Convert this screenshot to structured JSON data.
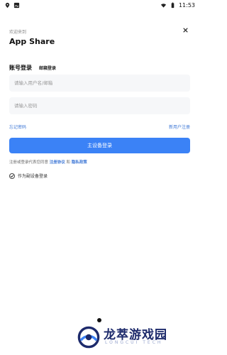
{
  "status_bar": {
    "time": "11:53",
    "left_icons": [
      "location-icon",
      "image-icon"
    ],
    "right_icons": [
      "wifi-icon",
      "battery-icon"
    ]
  },
  "header": {
    "welcome": "欢迎来到",
    "title": "App Share",
    "close_glyph": "×"
  },
  "tabs": {
    "account_login": "账号登录",
    "email_login": "邮箱登录",
    "active": "account_login"
  },
  "form": {
    "username_placeholder": "请输入用户名/邮箱",
    "username_value": "",
    "password_placeholder": "请输入密码",
    "password_value": ""
  },
  "links": {
    "forgot_password": "忘记密码",
    "register": "新用户注册"
  },
  "buttons": {
    "login": "主设备登录"
  },
  "agreement": {
    "prefix": "注册或登录代表您同意",
    "terms": "注册协议",
    "and": "和",
    "privacy": "隐私政策"
  },
  "as_secondary_device": {
    "label": "作为副设备登录",
    "checked": true
  },
  "watermark": {
    "text": "龙萃游戏园",
    "sub": "LONGCUI TECH"
  },
  "colors": {
    "accent": "#3b82f6",
    "link": "#3f78d6",
    "input_bg": "#f6f7f9",
    "watermark_dark": "#1d2a6b"
  }
}
